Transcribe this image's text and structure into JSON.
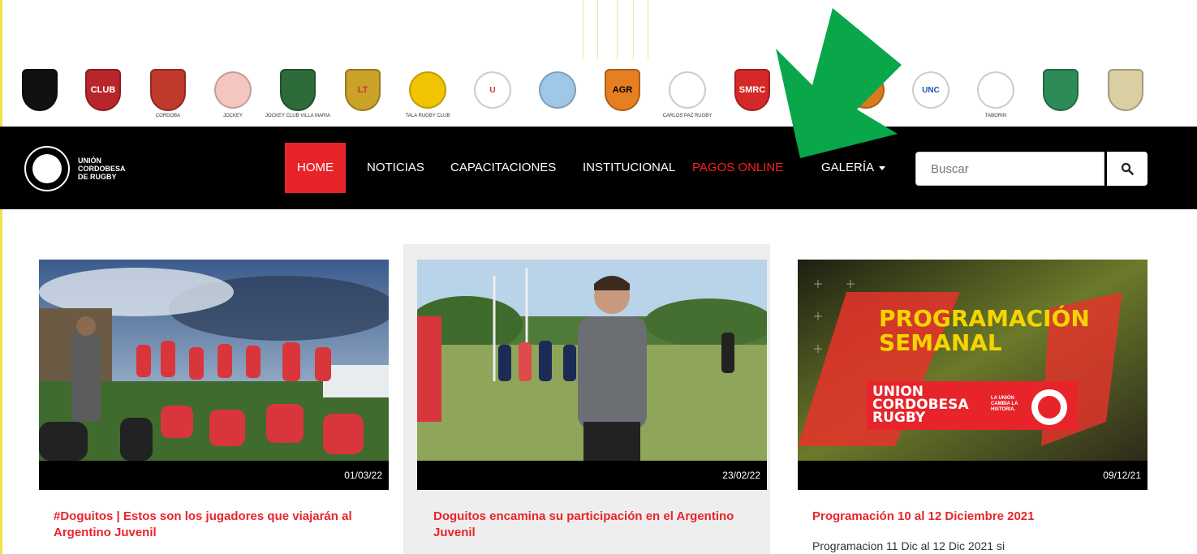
{
  "logos": [
    {
      "name": "club-logo-1",
      "label": "",
      "color": "#111",
      "fg": "#d4a017",
      "kind": "shield"
    },
    {
      "name": "club-logo-2",
      "label": "CLUB",
      "color": "#b8262c",
      "fg": "#fff",
      "kind": "shield"
    },
    {
      "name": "club-logo-3",
      "label": "CORDOBA",
      "color": "#c0392b",
      "fg": "#fff",
      "kind": "shield"
    },
    {
      "name": "club-logo-4",
      "label": "JOCKEY",
      "color": "#f5c6c0",
      "fg": "#c0392b",
      "kind": "circle"
    },
    {
      "name": "club-logo-5",
      "label": "JOCKEY CLUB VILLA MARIA",
      "color": "#2e6b3a",
      "fg": "#fff",
      "kind": "shield"
    },
    {
      "name": "club-logo-6",
      "label": "LT",
      "color": "#c9a227",
      "fg": "#c0392b",
      "kind": "shield"
    },
    {
      "name": "club-logo-7",
      "label": "TALA RUGBY CLUB",
      "color": "#f2c300",
      "fg": "#000",
      "kind": "circle"
    },
    {
      "name": "club-logo-8",
      "label": "U",
      "color": "#fff",
      "fg": "#c0392b",
      "kind": "circle"
    },
    {
      "name": "club-logo-9",
      "label": "",
      "color": "#9fc7e8",
      "fg": "#234",
      "kind": "circle"
    },
    {
      "name": "club-logo-10",
      "label": "AGR",
      "color": "#e67e22",
      "fg": "#000",
      "kind": "shield"
    },
    {
      "name": "club-logo-11",
      "label": "CARLOS PAZ RUGBY",
      "color": "#fff",
      "fg": "#1f2a5a",
      "kind": "circle"
    },
    {
      "name": "club-logo-12",
      "label": "SMRC",
      "color": "#d62828",
      "fg": "#fff",
      "kind": "shield"
    },
    {
      "name": "club-logo-13",
      "label": "",
      "color": "#d87a1e",
      "fg": "#000",
      "kind": "circle"
    },
    {
      "name": "club-logo-14",
      "label": "UNC",
      "color": "#fff",
      "fg": "#1a56b0",
      "kind": "circle"
    },
    {
      "name": "club-logo-15",
      "label": "TABORIN",
      "color": "#fff",
      "fg": "#2e8b57",
      "kind": "circle"
    },
    {
      "name": "club-logo-16",
      "label": "",
      "color": "#2e8b57",
      "fg": "#fff",
      "kind": "shield"
    },
    {
      "name": "club-logo-17",
      "label": "",
      "color": "#d9cfa2",
      "fg": "#2e6b3a",
      "kind": "shield"
    }
  ],
  "brand": {
    "line1": "UNIÓN",
    "line2": "CORDOBESA",
    "line3": "DE RUGBY"
  },
  "nav": {
    "home": "HOME",
    "noticias": "NOTICIAS",
    "capacitaciones": "CAPACITACIONES",
    "institucional": "INSTITUCIONAL",
    "pagos": "PAGOS ONLINE",
    "galeria": "GALERÍA"
  },
  "search": {
    "placeholder": "Buscar"
  },
  "cards": [
    {
      "date": "01/03/22",
      "title": "#Doguitos | Estos son los jugadores que viajarán al Argentino Juvenil"
    },
    {
      "date": "23/02/22",
      "title": "Doguitos encamina su participación en el Argentino Juvenil"
    },
    {
      "date": "09/12/21",
      "title": "Programación 10 al 12 Diciembre 2021",
      "excerpt": "Programacion 11 Dic al 12 Dic 2021 si",
      "promo": {
        "line1": "PROGRAMACIÓN",
        "line2": "SEMANAL",
        "brand1": "UNION",
        "brand2": "CORDOBESA",
        "brand3": "RUGBY",
        "tag": "LA UNIÓN CAMBIA LA HISTORIA."
      }
    }
  ],
  "colors": {
    "accent": "#e8242b",
    "nav_bg": "#000000",
    "arrow": "#0aa64a"
  }
}
